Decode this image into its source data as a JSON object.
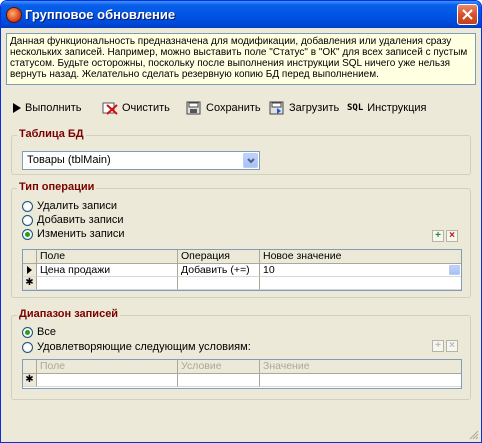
{
  "window": {
    "title": "Групповое обновление"
  },
  "info_text": "Данная функциональность предназначена для модификации, добавления или удаления сразу нескольких записей. Например, можно выставить поле \"Статус\" в \"ОК\" для всех записей с пустым статусом. Будьте осторожны, поскольку после выполнения инструкции SQL ничего уже нельзя вернуть назад. Желательно сделать резервную копию БД перед выполнением.",
  "toolbar": {
    "run": "Выполнить",
    "clear": "Очистить",
    "save": "Сохранить",
    "load": "Загрузить",
    "sql_icon": "SQL",
    "instruction": "Инструкция"
  },
  "table_group": {
    "legend": "Таблица БД",
    "selected": "Товары (tblMain)"
  },
  "operation_group": {
    "legend": "Тип операции",
    "options": [
      "Удалить записи",
      "Добавить записи",
      "Изменить записи"
    ],
    "selected_index": 2,
    "grid": {
      "columns": [
        "Поле",
        "Операция",
        "Новое значение"
      ],
      "rows": [
        {
          "field": "Цена продажи",
          "operation": "Добавить (+=)",
          "value": "10"
        }
      ]
    }
  },
  "range_group": {
    "legend": "Диапазон записей",
    "options": [
      "Все",
      "Удовлетворяющие следующим условиям:"
    ],
    "selected_index": 0,
    "grid": {
      "columns": [
        "Поле",
        "Условие",
        "Значение"
      ]
    }
  },
  "colors": {
    "title_bar": "#0055e5",
    "legend": "#7b0000",
    "info_bg": "#ffffe1",
    "window_bg": "#ece9d8"
  }
}
